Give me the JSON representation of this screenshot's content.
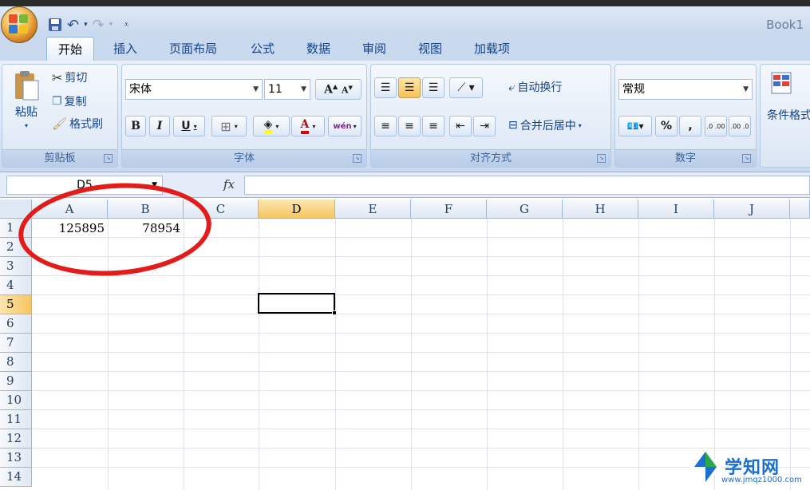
{
  "window": {
    "title": "Book1"
  },
  "tabs": [
    "开始",
    "插入",
    "页面布局",
    "公式",
    "数据",
    "审阅",
    "视图",
    "加载项"
  ],
  "active_tab": "开始",
  "clipboard": {
    "paste": "粘贴",
    "cut": "剪切",
    "copy": "复制",
    "format_painter": "格式刷",
    "label": "剪贴板"
  },
  "font": {
    "name": "宋体",
    "size": "11",
    "bold": "B",
    "italic": "I",
    "underline": "U",
    "label": "字体",
    "font_color_letter": "A",
    "phonetic": "wén"
  },
  "alignment": {
    "wrap": "自动换行",
    "merge": "合并后居中",
    "label": "对齐方式"
  },
  "number": {
    "format": "常规",
    "percent": "%",
    "comma": ",",
    "inc_decimal": ".0 .00",
    "dec_decimal": ".00 .0",
    "label": "数字"
  },
  "styles": {
    "conditional": "条件格式"
  },
  "formula_bar": {
    "name_box": "D5",
    "fx": "fx",
    "value": ""
  },
  "columns": [
    "A",
    "B",
    "C",
    "D",
    "E",
    "F",
    "G",
    "H",
    "I",
    "J"
  ],
  "rows": [
    "1",
    "2",
    "3",
    "4",
    "5",
    "6",
    "7",
    "8",
    "9",
    "10",
    "11",
    "12",
    "13",
    "14"
  ],
  "selected": {
    "column": "D",
    "row": "5"
  },
  "cells": {
    "A1": "125895",
    "B1": "78954"
  },
  "watermark": {
    "name": "学知网",
    "url": "www.jmqz1000.com"
  },
  "colors": {
    "accent": "#15428b",
    "highlight": "#f6c560",
    "annotation": "#e21b1b"
  }
}
